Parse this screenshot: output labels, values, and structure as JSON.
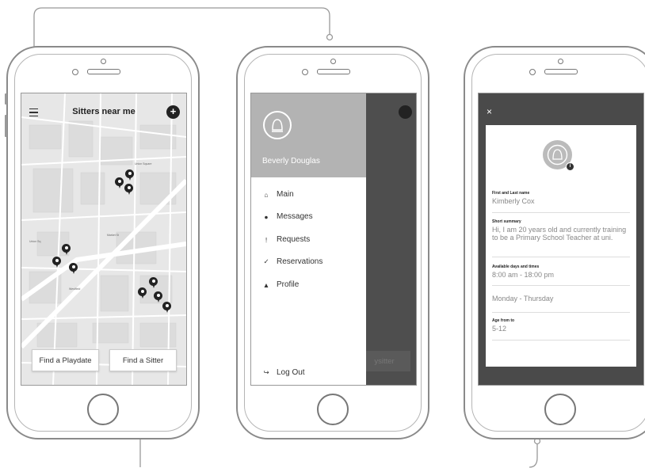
{
  "screen1": {
    "title": "Sitters near me",
    "plus_label": "+",
    "buttons": {
      "playdate": "Find a Playdate",
      "sitter": "Find a Sitter"
    }
  },
  "screen2": {
    "user_name": "Beverly Douglas",
    "items": [
      {
        "label": "Main",
        "icon": "home-icon",
        "glyph": "⌂"
      },
      {
        "label": "Messages",
        "icon": "chat-icon",
        "glyph": "●"
      },
      {
        "label": "Requests",
        "icon": "alert-icon",
        "glyph": "!"
      },
      {
        "label": "Reservations",
        "icon": "check-icon",
        "glyph": "✓"
      },
      {
        "label": "Profile",
        "icon": "person-icon",
        "glyph": "▲"
      }
    ],
    "logout": "Log Out",
    "behind_button": "ysitter"
  },
  "screen3": {
    "close": "×",
    "badge": "i",
    "fields": [
      {
        "label": "First and Last name",
        "value": "Kimberly Cox"
      },
      {
        "label": "Short summary",
        "value": "Hi, I am 20 years old and currently training to be a Primary School Teacher at uni."
      },
      {
        "label": "Available days and times",
        "value": "8:00 am - 18:00 pm"
      },
      {
        "label": "",
        "value": "Monday - Thursday"
      },
      {
        "label": "Age from to",
        "value": "5-12"
      }
    ]
  },
  "colors": {
    "map_bg": "#e7e7e7",
    "header_gray": "#b3b3b3",
    "overlay": "#4a4a4a",
    "pin": "#222222"
  }
}
